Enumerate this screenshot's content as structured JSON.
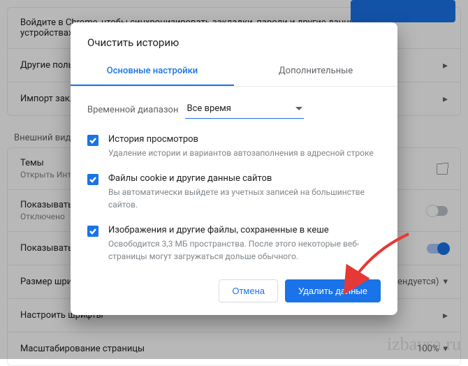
{
  "background": {
    "sync_text": "Войдите в Chrome, чтобы синхронизировать закладки, пароли и другие данные на всех устройствах",
    "rows1": {
      "other": "Другие пользователи",
      "import": "Импорт закладок и настроек"
    },
    "section2_title": "Внешний вид",
    "themes": {
      "title": "Темы",
      "sub": "Открыть Интернет-магазин Chrome"
    },
    "show_home": {
      "title": "Показывать кнопку \"Главная страница\"",
      "sub": "Отключено"
    },
    "show_bookmarks": "Показывать панель закладок",
    "font_size": {
      "title": "Размер шрифта",
      "value": "Средний (рекомендуется)"
    },
    "fonts": "Настроить шрифты",
    "zoom": {
      "title": "Масштабирование страницы",
      "value": "100%"
    }
  },
  "dialog": {
    "title": "Очистить историю",
    "tab_basic": "Основные настройки",
    "tab_advanced": "Дополнительные",
    "range_label": "Временной диапазон",
    "range_value": "Все время",
    "options": [
      {
        "title": "История просмотров",
        "desc": "Удаление истории и вариантов автозаполнения в адресной строке"
      },
      {
        "title": "Файлы cookie и другие данные сайтов",
        "desc": "Вы автоматически выйдете из учетных записей на большинстве сайтов."
      },
      {
        "title": "Изображения и другие файлы, сохраненные в кеше",
        "desc": "Освободится 3,3 МБ пространства. После этого некоторые веб-страницы могут загружаться дольше обычного."
      }
    ],
    "cancel": "Отмена",
    "confirm": "Удалить данные"
  },
  "watermark": "izbavsa.ru"
}
